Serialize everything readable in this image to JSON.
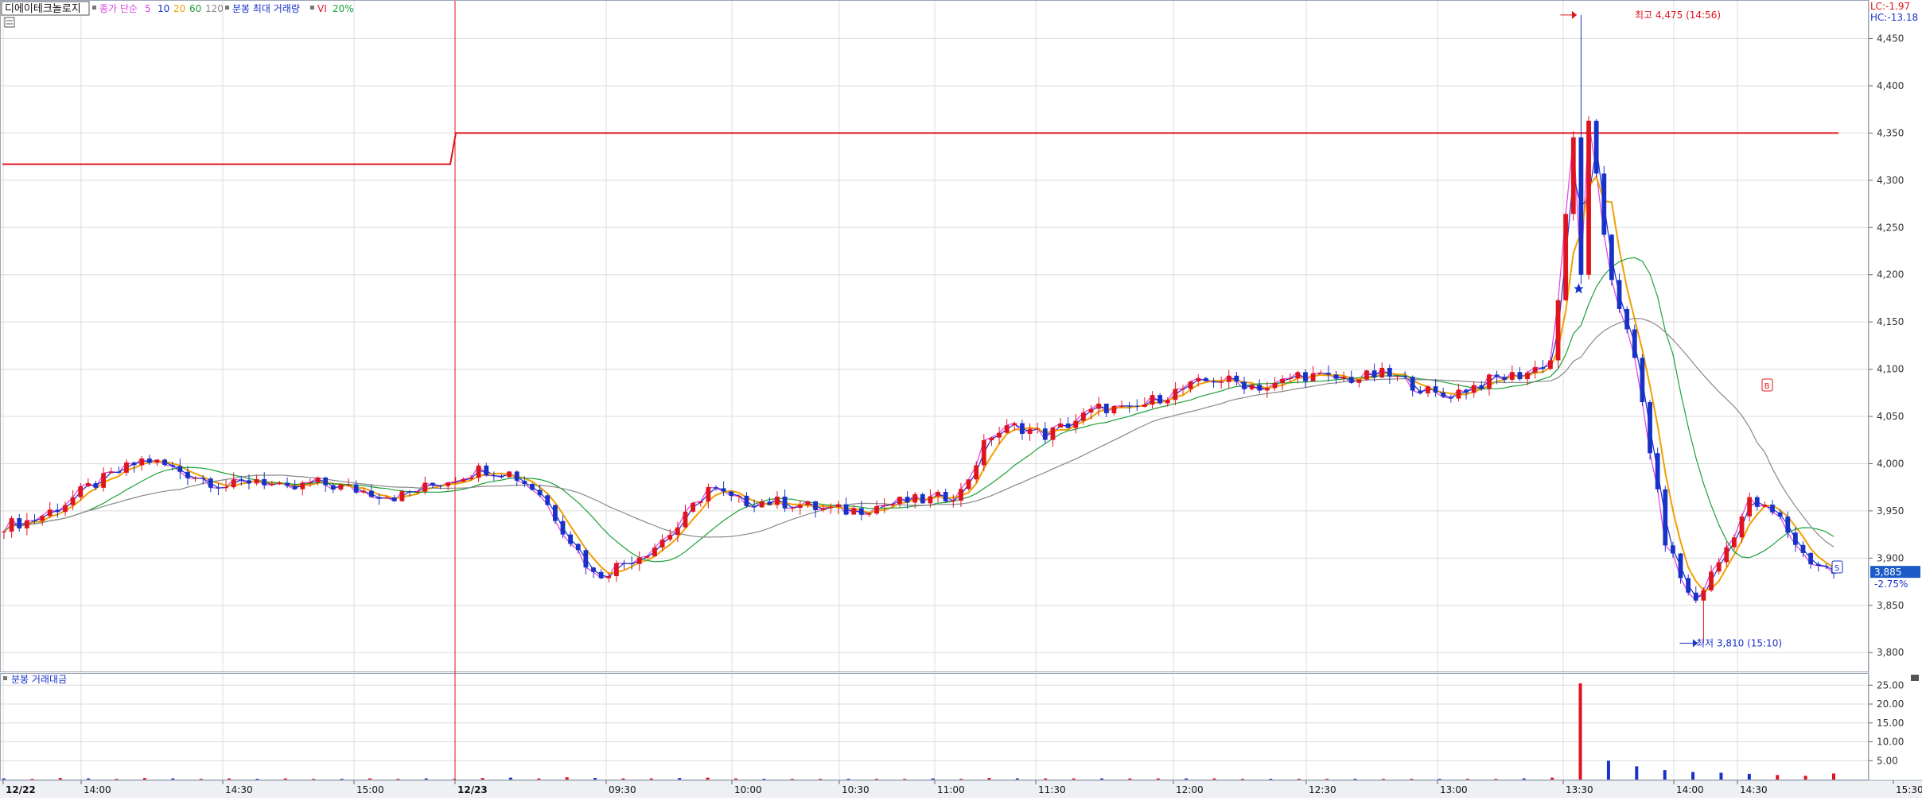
{
  "header": {
    "stock_name": "디에이테크놀로지",
    "ma_label": "종가 단순",
    "ma_periods": [
      "5",
      "10",
      "20",
      "60",
      "120"
    ],
    "ma_colors": [
      "#e040e0",
      "#1b2fd0",
      "#f0a000",
      "#1ea03a",
      "#888888"
    ],
    "vol_label": "분봉 최대 거래량",
    "vi_label": "VI",
    "vi_pct": "20%"
  },
  "top_right": {
    "lc": "LC:-1.97",
    "hc": "HC:-13.18"
  },
  "sub_panel": {
    "title": "분봉 거래대금"
  },
  "annotations": {
    "high": "최고 4,475 (14:56)",
    "low": "최저 3,810 (15:10)",
    "current_price": "3,885",
    "current_change": "-2.75%",
    "marker_b": "B",
    "marker_s": "S"
  },
  "chart_data": {
    "type": "candlestick",
    "sessions": [
      "12/22",
      "12/23"
    ],
    "time_ticks": [
      "12/22",
      "14:00",
      "14:30",
      "15:00",
      "12/23",
      "09:30",
      "10:00",
      "10:30",
      "11:00",
      "11:30",
      "12:00",
      "12:30",
      "13:00",
      "13:30",
      "14:00",
      "14:30",
      "15:30:00"
    ],
    "y_ticks": [
      "4,450",
      "4,400",
      "4,350",
      "4,300",
      "4,250",
      "4,200",
      "4,150",
      "4,100",
      "4,050",
      "4,000",
      "3,950",
      "3,900",
      "3,850",
      "3,800"
    ],
    "ylim": [
      3780,
      4490
    ],
    "volume_ticks": [
      "25.00",
      "20.00",
      "15.00",
      "10.00",
      "5.00"
    ],
    "volume_ylim": [
      0,
      28
    ],
    "vi_level_before": 4317,
    "vi_level_after": 4350,
    "high": 4475,
    "low": 3810,
    "last": 3885,
    "change_pct": -2.75,
    "colors": {
      "up": "#e0141e",
      "down": "#1832c8",
      "vi": "#e0141e",
      "grid": "#dcdcdc"
    },
    "price_path": [
      3935,
      3940,
      3955,
      3975,
      3990,
      4005,
      3995,
      3985,
      3975,
      3985,
      3970,
      3980,
      3975,
      3970,
      3965,
      3975,
      3985,
      3995,
      3990,
      3970,
      3925,
      3880,
      3895,
      3910,
      3935,
      3975,
      3960,
      3960,
      3958,
      3952,
      3950,
      3955,
      3960,
      3962,
      3970,
      4030,
      4040,
      4030,
      4045,
      4060,
      4055,
      4070,
      4080,
      4090,
      4085,
      4080,
      4095,
      4090,
      4090,
      4095,
      4085,
      4070,
      4080,
      4090,
      4095,
      4110,
      4420,
      4210,
      4100,
      3920,
      3850,
      3900,
      3960,
      3945,
      3900,
      3885
    ],
    "volume": [
      0.3,
      0.2,
      0.4,
      0.3,
      0.2,
      0.4,
      0.3,
      0.2,
      0.3,
      0.2,
      0.3,
      0.2,
      0.2,
      0.3,
      0.2,
      0.3,
      0.2,
      0.4,
      0.5,
      0.3,
      0.6,
      0.4,
      0.3,
      0.3,
      0.4,
      0.5,
      0.3,
      0.2,
      0.2,
      0.2,
      0.2,
      0.2,
      0.2,
      0.3,
      0.2,
      0.4,
      0.3,
      0.3,
      0.3,
      0.3,
      0.3,
      0.3,
      0.3,
      0.3,
      0.2,
      0.2,
      0.2,
      0.2,
      0.2,
      0.2,
      0.2,
      0.2,
      0.2,
      0.2,
      0.3,
      0.5,
      25.5,
      5.0,
      3.5,
      2.5,
      2.0,
      1.8,
      1.5,
      1.2,
      1.0,
      1.6
    ]
  }
}
